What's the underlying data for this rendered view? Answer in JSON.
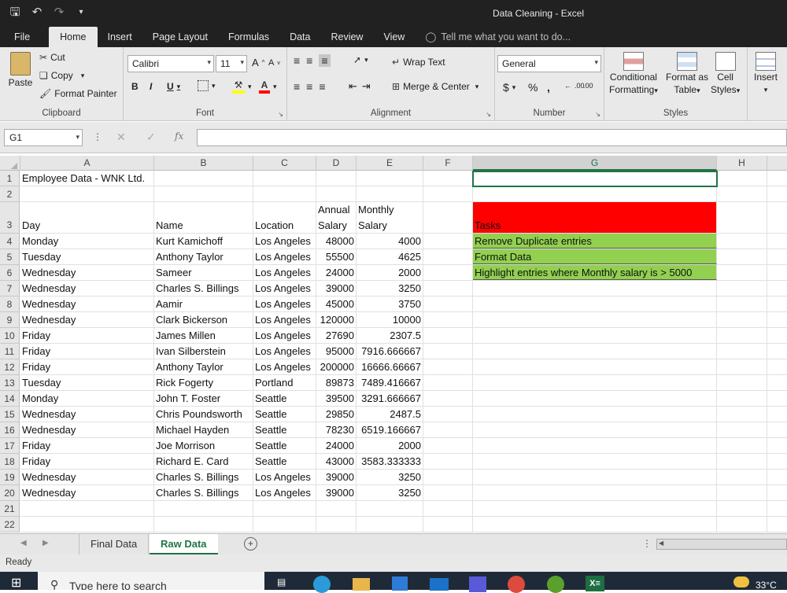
{
  "window": {
    "title": "Data Cleaning - Excel"
  },
  "ribbon_tabs": [
    "File",
    "Home",
    "Insert",
    "Page Layout",
    "Formulas",
    "Data",
    "Review",
    "View"
  ],
  "active_tab": "Home",
  "tell_me": "Tell me what you want to do...",
  "clipboard": {
    "paste": "Paste",
    "cut": "Cut",
    "copy": "Copy",
    "format_painter": "Format Painter",
    "label": "Clipboard"
  },
  "font": {
    "name": "Calibri",
    "size": "11",
    "bold": "B",
    "italic": "I",
    "underline": "U",
    "grow": "A",
    "shrink": "A",
    "label": "Font"
  },
  "alignment": {
    "wrap_text": "Wrap Text",
    "merge_center": "Merge & Center",
    "label": "Alignment"
  },
  "number": {
    "format": "General",
    "currency": "$",
    "percent": "%",
    "comma": ",",
    "inc_decimal": ".00",
    "dec_decimal": ".00",
    "label": "Number"
  },
  "styles": {
    "conditional": "Conditional",
    "conditional2": "Formatting",
    "format_as": "Format as",
    "format_as2": "Table",
    "cell": "Cell",
    "cell2": "Styles",
    "label": "Styles"
  },
  "cells_group": {
    "insert": "Insert"
  },
  "formula_bar": {
    "name_box": "G1",
    "fx": "fx",
    "value": ""
  },
  "columns": [
    "A",
    "B",
    "C",
    "D",
    "E",
    "F",
    "G",
    "H"
  ],
  "selected_column": "G",
  "rows": [
    {
      "n": "1",
      "A": "Employee Data - WNK Ltd.",
      "B": "",
      "C": "",
      "D": "",
      "E": "",
      "G": ""
    },
    {
      "n": "2",
      "A": "",
      "B": "",
      "C": "",
      "D": "",
      "E": "",
      "G": ""
    },
    {
      "n": "3",
      "A": "Day",
      "B": "Name",
      "C": "Location",
      "D": "Annual",
      "D2": "Salary",
      "E": "Monthly",
      "E2": "Salary",
      "G": "Tasks"
    },
    {
      "n": "4",
      "A": "Monday",
      "B": "Kurt Kamichoff",
      "C": "Los Angeles",
      "D": "48000",
      "E": "4000",
      "G": "Remove Duplicate entries"
    },
    {
      "n": "5",
      "A": "Tuesday",
      "B": "Anthony Taylor",
      "C": "Los Angeles",
      "D": "55500",
      "E": "4625",
      "G": "Format Data"
    },
    {
      "n": "6",
      "A": "Wednesday",
      "B": "Sameer",
      "C": "Los Angeles",
      "D": "24000",
      "E": "2000",
      "G": "Highlight entries where Monthly salary is > 5000"
    },
    {
      "n": "7",
      "A": "Wednesday",
      "B": "Charles S. Billings",
      "C": "Los Angeles",
      "D": "39000",
      "E": "3250",
      "G": ""
    },
    {
      "n": "8",
      "A": "Wednesday",
      "B": "Aamir",
      "C": "Los Angeles",
      "D": "45000",
      "E": "3750",
      "G": ""
    },
    {
      "n": "9",
      "A": "Wednesday",
      "B": "Clark Bickerson",
      "C": "Los Angeles",
      "D": "120000",
      "E": "10000",
      "G": ""
    },
    {
      "n": "10",
      "A": "Friday",
      "B": "James Millen",
      "C": "Los Angeles",
      "D": "27690",
      "E": "2307.5",
      "G": ""
    },
    {
      "n": "11",
      "A": "Friday",
      "B": "Ivan Silberstein",
      "C": "Los Angeles",
      "D": "95000",
      "E": "7916.666667",
      "G": ""
    },
    {
      "n": "12",
      "A": "Friday",
      "B": "Anthony Taylor",
      "C": "Los Angeles",
      "D": "200000",
      "E": "16666.66667",
      "G": ""
    },
    {
      "n": "13",
      "A": "Tuesday",
      "B": "Rick Fogerty",
      "C": "Portland",
      "D": "89873",
      "E": "7489.416667",
      "G": ""
    },
    {
      "n": "14",
      "A": "Monday",
      "B": "John T. Foster",
      "C": "Seattle",
      "D": "39500",
      "E": "3291.666667",
      "G": ""
    },
    {
      "n": "15",
      "A": "Wednesday",
      "B": "Chris Poundsworth",
      "C": "Seattle",
      "D": "29850",
      "E": "2487.5",
      "G": ""
    },
    {
      "n": "16",
      "A": "Wednesday",
      "B": "Michael Hayden",
      "C": "Seattle",
      "D": "78230",
      "E": "6519.166667",
      "G": ""
    },
    {
      "n": "17",
      "A": "Friday",
      "B": "Joe Morrison",
      "C": "Seattle",
      "D": "24000",
      "E": "2000",
      "G": ""
    },
    {
      "n": "18",
      "A": "Friday",
      "B": "Richard E. Card",
      "C": "Seattle",
      "D": "43000",
      "E": "3583.333333",
      "G": ""
    },
    {
      "n": "19",
      "A": "Wednesday",
      "B": "Charles S. Billings",
      "C": "Los Angeles",
      "D": "39000",
      "E": "3250",
      "G": ""
    },
    {
      "n": "20",
      "A": "Wednesday",
      "B": "Charles S. Billings",
      "C": "Los Angeles",
      "D": "39000",
      "E": "3250",
      "G": ""
    },
    {
      "n": "21",
      "A": "",
      "B": "",
      "C": "",
      "D": "",
      "E": "",
      "G": ""
    },
    {
      "n": "22",
      "A": "",
      "B": "",
      "C": "",
      "D": "",
      "E": "",
      "G": ""
    }
  ],
  "sheets": [
    "Final Data",
    "Raw Data"
  ],
  "active_sheet": "Raw Data",
  "status": "Ready",
  "taskbar": {
    "search_placeholder": "Type here to search",
    "temperature": "33°C"
  },
  "colors": {
    "accent": "#217346",
    "task_header": "#ff0000",
    "task_item": "#92d050"
  }
}
